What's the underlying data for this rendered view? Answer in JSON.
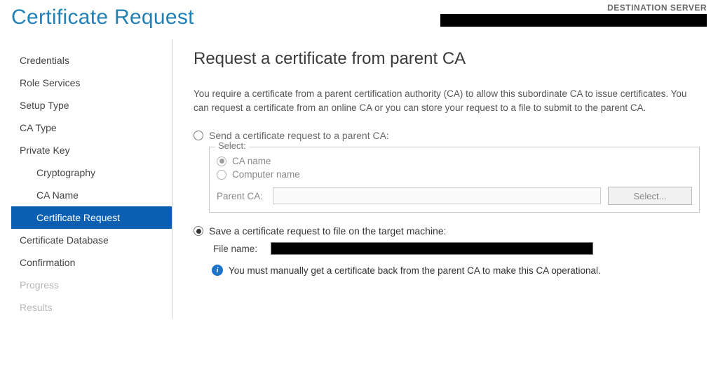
{
  "header": {
    "title": "Certificate Request",
    "dest_label": "DESTINATION SERVER"
  },
  "sidebar": {
    "items": [
      {
        "label": "Credentials",
        "sub": false,
        "state": "normal"
      },
      {
        "label": "Role Services",
        "sub": false,
        "state": "normal"
      },
      {
        "label": "Setup Type",
        "sub": false,
        "state": "normal"
      },
      {
        "label": "CA Type",
        "sub": false,
        "state": "normal"
      },
      {
        "label": "Private Key",
        "sub": false,
        "state": "normal"
      },
      {
        "label": "Cryptography",
        "sub": true,
        "state": "normal"
      },
      {
        "label": "CA Name",
        "sub": true,
        "state": "normal"
      },
      {
        "label": "Certificate Request",
        "sub": true,
        "state": "selected"
      },
      {
        "label": "Certificate Database",
        "sub": false,
        "state": "normal"
      },
      {
        "label": "Confirmation",
        "sub": false,
        "state": "normal"
      },
      {
        "label": "Progress",
        "sub": false,
        "state": "disabled"
      },
      {
        "label": "Results",
        "sub": false,
        "state": "disabled"
      }
    ]
  },
  "content": {
    "title": "Request a certificate from parent CA",
    "description": "You require a certificate from a parent certification authority (CA) to allow this subordinate CA to issue certificates. You can request a certificate from an online CA or you can store your request to a file to submit to the parent CA.",
    "option_send_label": "Send a certificate request to a parent CA:",
    "fieldset_legend": "Select:",
    "sub_ca_name": "CA name",
    "sub_computer_name": "Computer name",
    "parent_ca_label": "Parent CA:",
    "select_button": "Select...",
    "option_save_label": "Save a certificate request to file on the target machine:",
    "file_name_label": "File name:",
    "info_text": "You must manually get a certificate back from the parent CA to make this CA operational."
  }
}
